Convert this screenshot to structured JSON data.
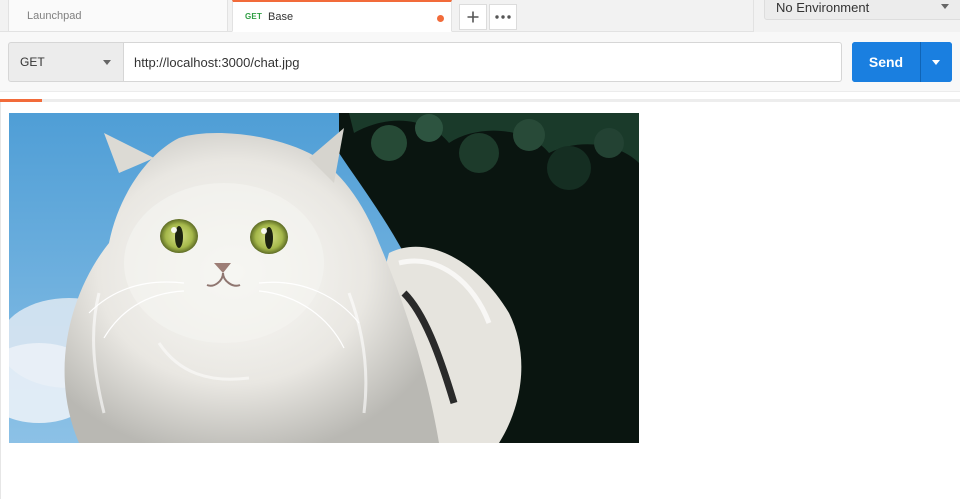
{
  "tabs": [
    {
      "label": "Launchpad"
    },
    {
      "method": "GET",
      "label": "Base",
      "unsaved": true
    }
  ],
  "tab_actions": {
    "new_icon": "plus-icon",
    "more_icon": "ellipsis-icon"
  },
  "environment": {
    "selected": "No Environment"
  },
  "request": {
    "method": "GET",
    "url": "http://localhost:3000/chat.jpg"
  },
  "send": {
    "label": "Send"
  },
  "response": {
    "progress_fraction": 0.044,
    "image_subject": "white persian cat"
  },
  "colors": {
    "accent": "#f26b3a",
    "send_button": "#1a7fe0",
    "method_get": "#2f9e44"
  }
}
